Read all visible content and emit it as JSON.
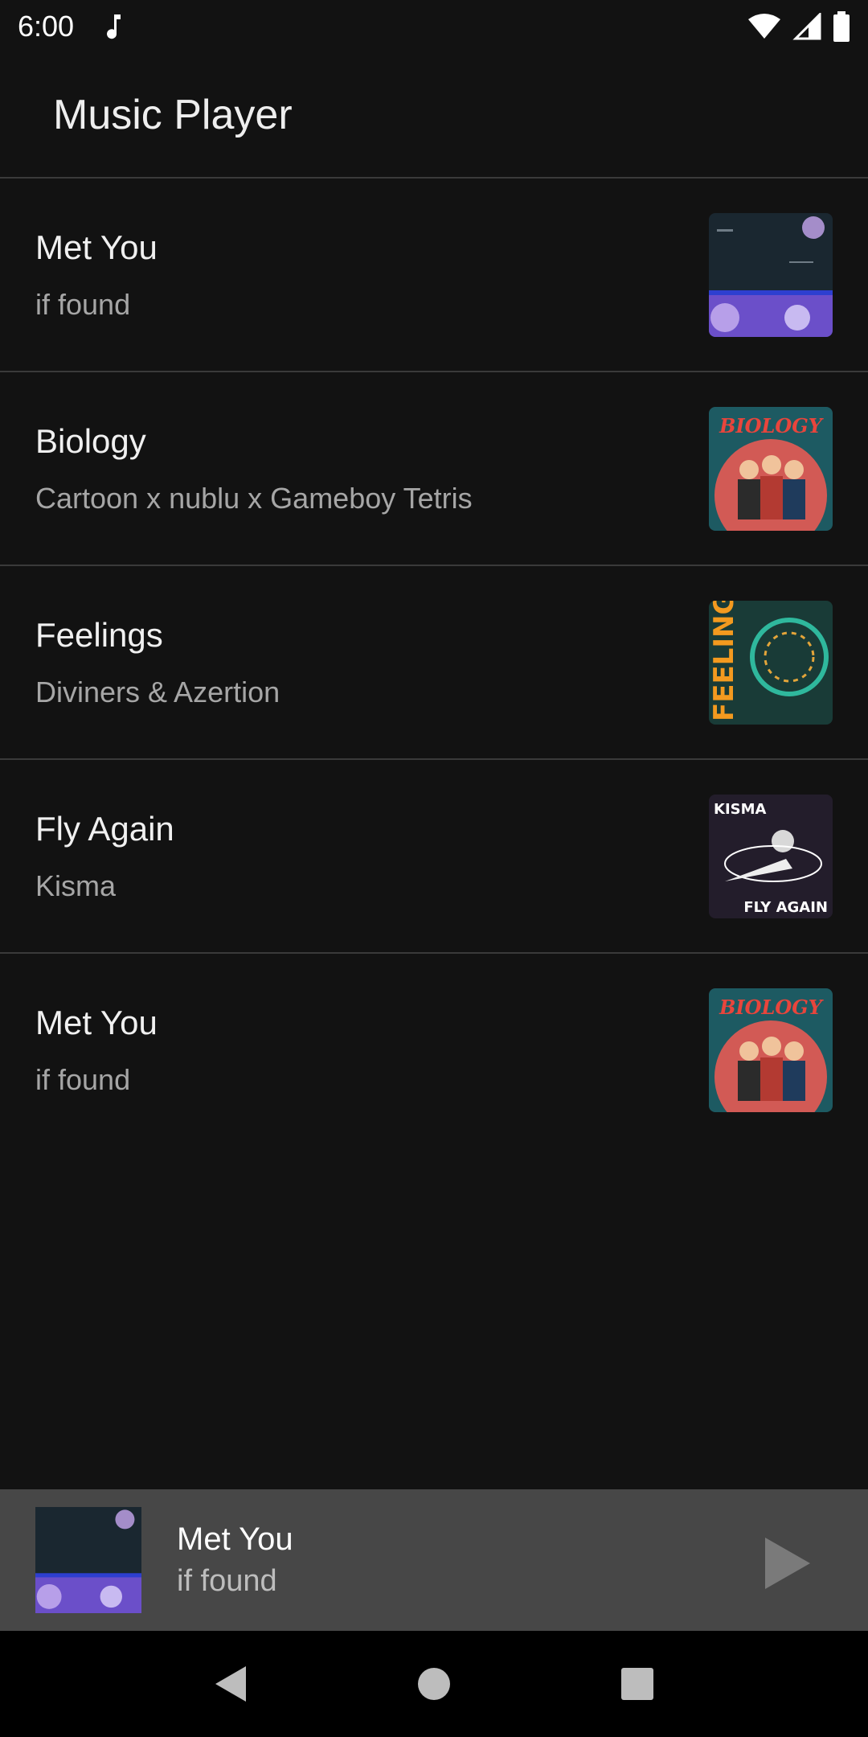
{
  "status_bar": {
    "time": "6:00"
  },
  "app": {
    "title": "Music Player"
  },
  "songs": [
    {
      "title": "Met You",
      "artist": "if found",
      "art": "art-metyou-icon"
    },
    {
      "title": "Biology",
      "artist": "Cartoon x nublu x Gameboy Tetris",
      "art": "art-biology-icon"
    },
    {
      "title": "Feelings",
      "artist": "Diviners & Azertion",
      "art": "art-feelings-icon"
    },
    {
      "title": "Fly Again",
      "artist": "Kisma",
      "art": "art-flyagain-icon"
    },
    {
      "title": "Met You",
      "artist": "if found",
      "art": "art-biology-icon"
    }
  ],
  "art_text": {
    "biology": "BIOLOGY",
    "feelings": "FEELINGS",
    "kisma": "KISMA",
    "fly_again": "FLY AGAIN"
  },
  "now_playing": {
    "title": "Met You",
    "artist": "if found",
    "state": "paused"
  },
  "colors": {
    "background": "#121212",
    "now_playing_bar": "#474747",
    "navbar": "#000000",
    "divider": "#3a3a3a"
  }
}
